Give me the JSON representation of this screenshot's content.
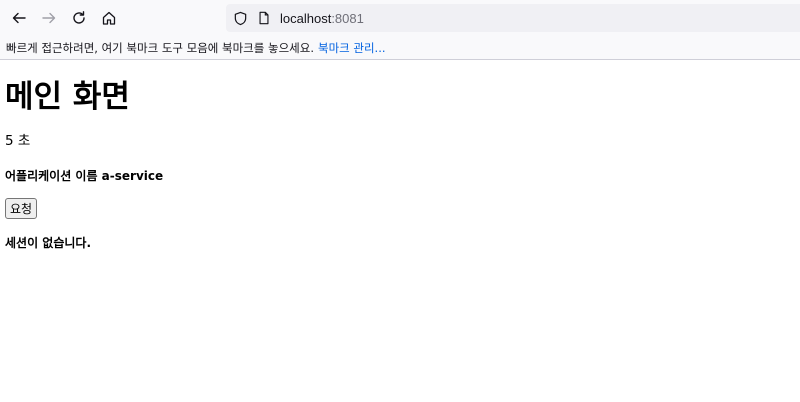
{
  "browser": {
    "url_host": "localhost",
    "url_port": ":8081",
    "bookmarks_hint": "빠르게 접근하려면, 여기 북마크 도구 모음에 북마크를 놓으세요.",
    "bookmarks_manage": "북마크 관리..."
  },
  "page": {
    "title": "메인 화면",
    "timer": "5 초",
    "app_name": "어플리케이션 이름 a-service",
    "request_button": "요청",
    "session_status": "세션이 없습니다."
  },
  "icons": [
    "back-icon",
    "forward-icon",
    "reload-icon",
    "home-icon",
    "shield-icon",
    "page-icon"
  ]
}
